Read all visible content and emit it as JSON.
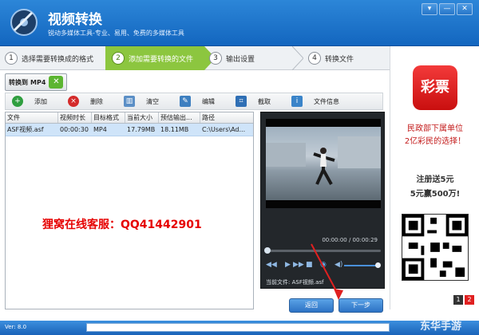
{
  "window": {
    "title": "视频转换",
    "subtitle": "锐动多媒体工具-专业、易用、免费的多媒体工具",
    "buttons": [
      "▾",
      "—",
      "✕"
    ]
  },
  "steps": [
    {
      "num": "1",
      "label": "选择需要转换成的格式"
    },
    {
      "num": "2",
      "label": "添加需要转换的文件"
    },
    {
      "num": "3",
      "label": "输出设置"
    },
    {
      "num": "4",
      "label": "转换文件"
    }
  ],
  "convert_button": {
    "label": "转换到",
    "format": "MP4"
  },
  "toolbar": [
    {
      "label": "添加",
      "icon": "add-icon"
    },
    {
      "label": "删除",
      "icon": "delete-icon"
    },
    {
      "label": "清空",
      "icon": "clear-icon"
    },
    {
      "label": "编辑",
      "icon": "edit-icon"
    },
    {
      "label": "截取",
      "icon": "crop-icon"
    },
    {
      "label": "文件信息",
      "icon": "info-icon"
    }
  ],
  "table": {
    "headers": [
      "文件",
      "视频时长",
      "目标格式",
      "当前大小",
      "预估输出...",
      "路径"
    ],
    "rows": [
      [
        "ASF视频.asf",
        "00:00:30",
        "MP4",
        "17.79MB",
        "18.11MB",
        "C:\\Users\\Ad..."
      ]
    ]
  },
  "service_text": "狸窝在线客服：QQ41442901",
  "player": {
    "time": "00:00:00 / 00:00:29",
    "current_file": "当前文件: ASF视频.asf"
  },
  "nav": {
    "back": "返回",
    "next": "下一步"
  },
  "ad": {
    "logo": "彩票",
    "line1": "民政部下属单位",
    "line2": "2亿彩民的选择！",
    "line3": "注册送5元",
    "line4": "5元赢500万!",
    "pages": [
      "1",
      "2"
    ]
  },
  "status": {
    "version": "Ver: 8.0",
    "watermark": "东华手游"
  }
}
